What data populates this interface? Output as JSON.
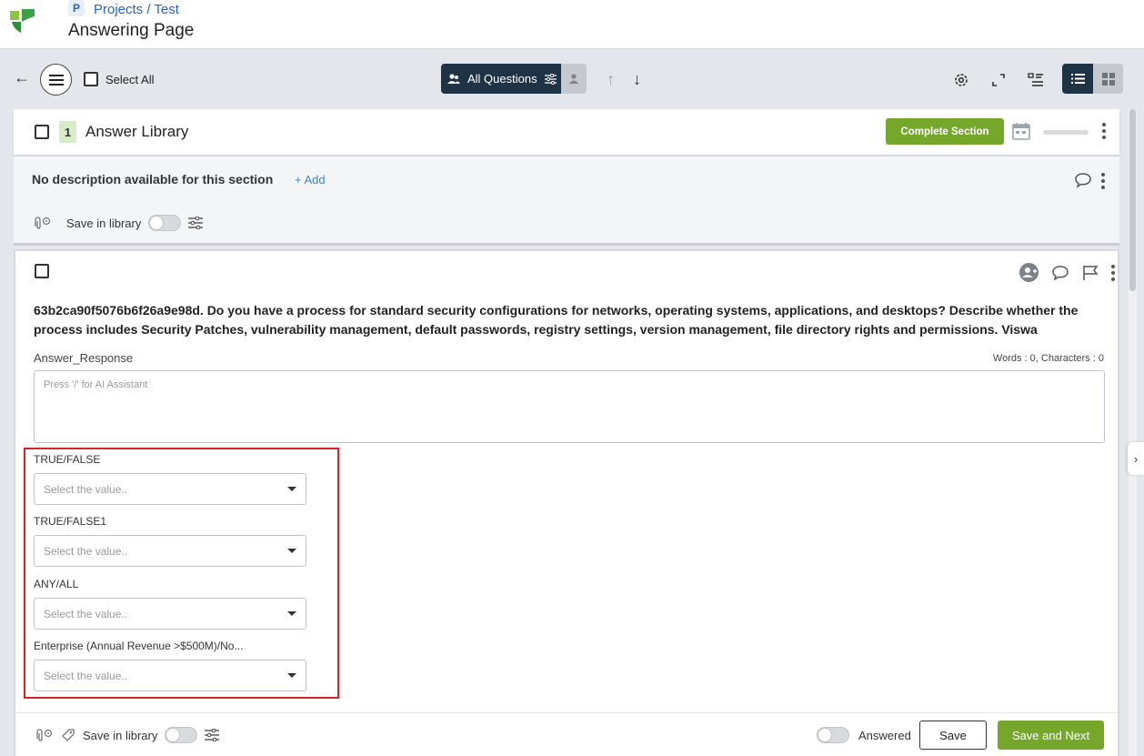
{
  "header": {
    "breadcrumb": "Projects / Test",
    "page_title": "Answering Page",
    "crumb_icon_letter": "P"
  },
  "toolbar": {
    "select_all": "Select All",
    "filter_label": "All Questions"
  },
  "section": {
    "number": "1",
    "title": "Answer Library",
    "complete_label": "Complete Section",
    "description": "No description available for this section",
    "add_label": "+ Add",
    "save_in_library": "Save in library"
  },
  "question": {
    "text": "63b2ca90f5076b6f26a9e98d. Do you have a process for standard security configurations for networks, operating systems, applications, and desktops? Describe whether the process includes Security Patches, vulnerability management, default passwords, registry settings, version management, file directory rights and permissions. Viswa",
    "answer_label": "Answer_Response",
    "counter": "Words : 0, Characters : 0",
    "answer_placeholder": "Press '/' for AI Assistant",
    "fields": [
      {
        "label": "TRUE/FALSE",
        "placeholder": "Select the value.."
      },
      {
        "label": "TRUE/FALSE1",
        "placeholder": "Select the value.."
      },
      {
        "label": "ANY/ALL",
        "placeholder": "Select the value.."
      },
      {
        "label": "Enterprise (Annual Revenue >$500M)/No...",
        "placeholder": "Select the value.."
      }
    ],
    "save_in_library": "Save in library",
    "answered_label": "Answered",
    "save_label": "Save",
    "save_next_label": "Save and Next"
  },
  "colors": {
    "brand_green": "#75a72a",
    "navy": "#1f3347",
    "link_blue": "#2b63c7",
    "highlight_red": "#d8232a"
  }
}
